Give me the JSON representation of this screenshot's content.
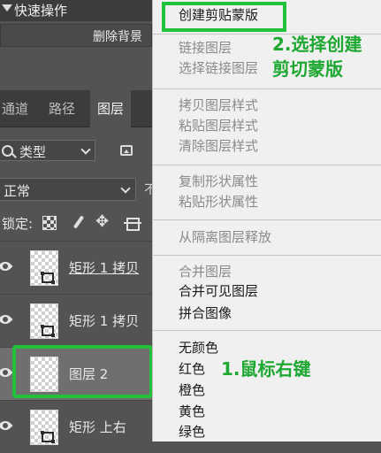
{
  "quick_actions": {
    "title": "快速操作",
    "remove_bg": "删除背景"
  },
  "tabs": [
    {
      "label": "通道"
    },
    {
      "label": "路径"
    },
    {
      "label": "图层"
    }
  ],
  "filter": {
    "kind_label": "类型"
  },
  "blend": {
    "mode": "正常",
    "opacity_peek": "不"
  },
  "lock": {
    "label": "锁定:"
  },
  "layers": [
    {
      "name": "矩形 1 拷贝"
    },
    {
      "name": "矩形 1 拷贝"
    },
    {
      "name": "图层 2"
    },
    {
      "name": "矩形  上右"
    }
  ],
  "menu": {
    "items": [
      {
        "label": "创建剪贴蒙版",
        "enabled": true
      },
      {
        "label": "链接图层",
        "enabled": false
      },
      {
        "label": "选择链接图层",
        "enabled": false
      },
      {
        "label": "拷贝图层样式",
        "enabled": false
      },
      {
        "label": "粘贴图层样式",
        "enabled": false
      },
      {
        "label": "清除图层样式",
        "enabled": false
      },
      {
        "label": "复制形状属性",
        "enabled": false
      },
      {
        "label": "粘贴形状属性",
        "enabled": false
      },
      {
        "label": "从隔离图层释放",
        "enabled": false
      },
      {
        "label": "合并图层",
        "enabled": false
      },
      {
        "label": "合并可见图层",
        "enabled": true
      },
      {
        "label": "拼合图像",
        "enabled": true
      },
      {
        "label": "无颜色",
        "enabled": true
      },
      {
        "label": "红色",
        "enabled": true
      },
      {
        "label": "橙色",
        "enabled": true
      },
      {
        "label": "黄色",
        "enabled": true
      },
      {
        "label": "绿色",
        "enabled": true
      }
    ]
  },
  "annotations": {
    "step2_line1": "2.选择创建",
    "step2_line2": "剪切蒙版",
    "step1": "1.鼠标右键"
  },
  "colors": {
    "highlight": "#20c23a",
    "annotation_text": "#1ea832"
  }
}
